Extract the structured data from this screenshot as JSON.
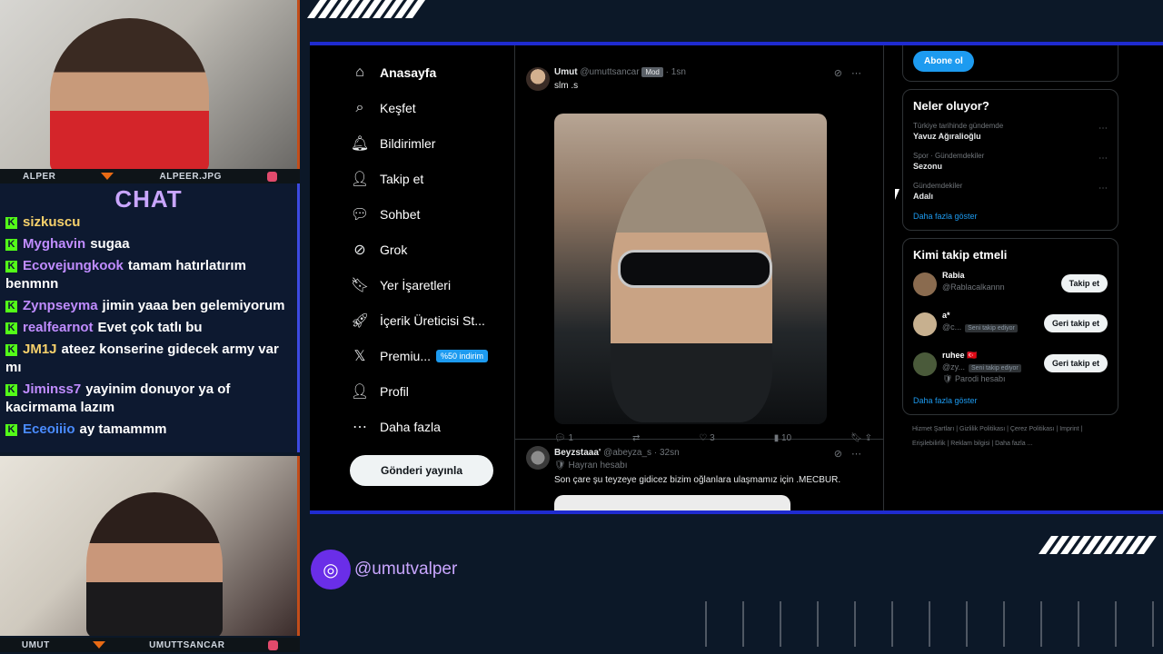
{
  "overlay": {
    "top_cam_labels": [
      "ALPER",
      "ALPEER.JPG"
    ],
    "bottom_cam_labels": [
      "UMUT",
      "UMUTTSANCAR"
    ],
    "chat_title": "CHAT",
    "chat_messages": [
      {
        "user": "sizkuscu",
        "text": "",
        "color": "#f6d16b"
      },
      {
        "user": "Myghavin",
        "text": "sugaa",
        "color": "#c08cff"
      },
      {
        "user": "Ecovejungkook",
        "text": "tamam hatırlatırım benmnn",
        "color": "#c08cff"
      },
      {
        "user": "Zynpseyma",
        "text": "jimin yaaa ben gelemiyorum",
        "color": "#c08cff"
      },
      {
        "user": "realfearnot",
        "text": "Evet çok tatlı bu",
        "color": "#c08cff"
      },
      {
        "user": "JM1J",
        "text": "ateez konserine gidecek army var mı",
        "color": "#f6d16b"
      },
      {
        "user": "Jiminss7",
        "text": "yayinim donuyor ya of kacirmama lazım",
        "color": "#c08cff"
      },
      {
        "user": "Eceoiiio",
        "text": "ay tamammm",
        "color": "#4a8cff"
      }
    ],
    "handle": "@umutvalper"
  },
  "sidebar": {
    "items": [
      {
        "label": "Anasayfa",
        "icon": "home-icon",
        "glyph": "⌂"
      },
      {
        "label": "Keşfet",
        "icon": "search-icon",
        "glyph": "⌕"
      },
      {
        "label": "Bildirimler",
        "icon": "bell-icon",
        "glyph": "🔔︎"
      },
      {
        "label": "Takip et",
        "icon": "follow-icon",
        "glyph": "👤︎"
      },
      {
        "label": "Sohbet",
        "icon": "chat-icon",
        "glyph": "💬︎"
      },
      {
        "label": "Grok",
        "icon": "grok-icon",
        "glyph": "⊘"
      },
      {
        "label": "Yer İşaretleri",
        "icon": "bookmark-icon",
        "glyph": "🔖︎"
      },
      {
        "label": "İçerik Üreticisi St...",
        "icon": "rocket-icon",
        "glyph": "🚀︎"
      },
      {
        "label": "Premiu...",
        "icon": "x-logo-icon",
        "glyph": "𝕏",
        "badge": "%50 indirim"
      },
      {
        "label": "Profil",
        "icon": "profile-icon",
        "glyph": "👤︎"
      },
      {
        "label": "Daha fazla",
        "icon": "more-icon",
        "glyph": "⋯"
      }
    ],
    "post_button": "Gönderi yayınla"
  },
  "tweets": [
    {
      "name": "Umut",
      "handle": "@umuttsancar",
      "mod": "Mod",
      "time": "· 1sn",
      "text": "slm .s",
      "reply": "1",
      "retweet": "",
      "likes": "3",
      "views": "10"
    },
    {
      "name": "Beyzstaaa'",
      "handle": "@abeyza_s",
      "time": "· 32sn",
      "sub": "Hayran hesabı",
      "text": "Son çare şu teyzeye gidicez bizim oğlanlara ulaşmamız için .MECBUR."
    }
  ],
  "right": {
    "subscribe_button": "Abone ol",
    "trends_title": "Neler oluyor?",
    "trends": [
      {
        "category": "Türkiye tarihinde gündemde",
        "name": "Yavuz Ağıralioğlu"
      },
      {
        "category": "Spor · Gündemdekiler",
        "name": "Sezonu"
      },
      {
        "category": "Gündemdekiler",
        "name": "Adalı"
      }
    ],
    "show_more": "Daha fazla göster",
    "who_title": "Kimi takip etmeli",
    "who": [
      {
        "name": "Rabia",
        "handle": "@Rablacalkannn",
        "tag": "",
        "button": "Takip et"
      },
      {
        "name": "a*",
        "handle": "@c...",
        "tag": "Seni takip ediyor",
        "button": "Geri takip et"
      },
      {
        "name": "ruhee 🇹🇷",
        "handle": "@zy...",
        "tag": "Seni takip ediyor",
        "sub": "Parodi hesabı",
        "button": "Geri takip et"
      }
    ],
    "footer": "Hizmet Şartları | Gizlilik Politikası | Çerez Politikası | Imprint | Erişilebilirlik | Reklam bilgisi | Daha fazla ..."
  }
}
